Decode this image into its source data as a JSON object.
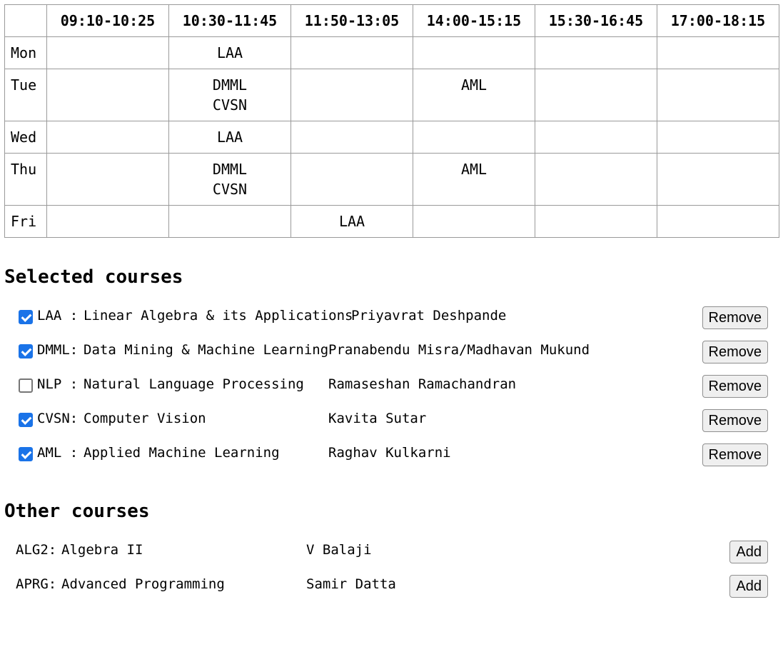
{
  "schedule": {
    "slots": [
      "09:10-10:25",
      "10:30-11:45",
      "11:50-13:05",
      "14:00-15:15",
      "15:30-16:45",
      "17:00-18:15"
    ],
    "rows": [
      {
        "day": "Mon",
        "cells": [
          [],
          [
            "LAA"
          ],
          [],
          [],
          [],
          []
        ]
      },
      {
        "day": "Tue",
        "cells": [
          [],
          [
            "DMML",
            "CVSN"
          ],
          [],
          [
            "AML"
          ],
          [],
          []
        ]
      },
      {
        "day": "Wed",
        "cells": [
          [],
          [
            "LAA"
          ],
          [],
          [],
          [],
          []
        ]
      },
      {
        "day": "Thu",
        "cells": [
          [],
          [
            "DMML",
            "CVSN"
          ],
          [],
          [
            "AML"
          ],
          [],
          []
        ]
      },
      {
        "day": "Fri",
        "cells": [
          [],
          [],
          [
            "LAA"
          ],
          [],
          [],
          []
        ]
      }
    ]
  },
  "selected": {
    "heading": "Selected courses",
    "button_label": "Remove",
    "courses": [
      {
        "checked": true,
        "code": "LAA :",
        "name": "Linear Algebra & its Applications",
        "prof": "Priyavrat Deshpande"
      },
      {
        "checked": true,
        "code": "DMML:",
        "name": "Data Mining & Machine Learning",
        "prof": "Pranabendu Misra/Madhavan Mukund"
      },
      {
        "checked": false,
        "code": "NLP :",
        "name": "Natural Language Processing",
        "prof": "Ramaseshan Ramachandran"
      },
      {
        "checked": true,
        "code": "CVSN:",
        "name": "Computer Vision",
        "prof": "Kavita Sutar"
      },
      {
        "checked": true,
        "code": "AML :",
        "name": "Applied Machine Learning",
        "prof": "Raghav Kulkarni"
      }
    ]
  },
  "other": {
    "heading": "Other courses",
    "button_label": "Add",
    "courses": [
      {
        "code": "ALG2:",
        "name": "Algebra II",
        "prof": "V Balaji"
      },
      {
        "code": "APRG:",
        "name": "Advanced Programming",
        "prof": "Samir Datta"
      }
    ]
  },
  "colors": {
    "checkbox_checked": "#1a73e8",
    "grid_border": "#9a9a9a",
    "button_bg": "#efefef"
  }
}
